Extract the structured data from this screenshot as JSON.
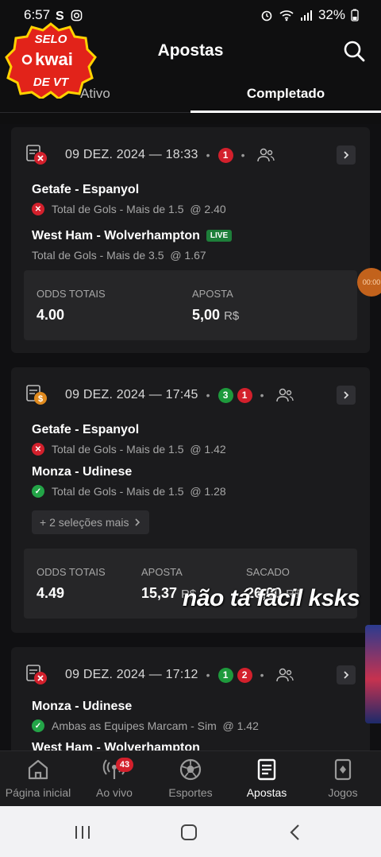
{
  "status_bar": {
    "time": "6:57",
    "battery": "32%"
  },
  "overlay_badge": {
    "line1": "SELO",
    "line2": "kwai",
    "line3": "DE VT"
  },
  "header": {
    "title": "Apostas"
  },
  "tabs": [
    {
      "label": "Ativo",
      "active": false
    },
    {
      "label": "Completado",
      "active": true
    }
  ],
  "bets": [
    {
      "datetime": "09 DEZ. 2024 — 18:33",
      "won_count": null,
      "lost_count": "1",
      "status_icon": "ticket-lost-icon",
      "selections": [
        {
          "match": "Getafe - Espanyol",
          "market": "Total de Gols - Mais de 1.5",
          "odd": "@ 2.40",
          "result": "lost",
          "live": false
        },
        {
          "match": "West Ham - Wolverhampton",
          "market": "Total de Gols - Mais de 3.5",
          "odd": "@ 1.67",
          "result": null,
          "live": true,
          "live_label": "LIVE"
        }
      ],
      "summary": {
        "odds_label": "ODDS TOTAIS",
        "odds_value": "4.00",
        "stake_label": "APOSTA",
        "stake_value": "5,00",
        "currency": "R$"
      }
    },
    {
      "datetime": "09 DEZ. 2024 — 17:45",
      "won_count": "3",
      "lost_count": "1",
      "status_icon": "ticket-cashout-icon",
      "selections": [
        {
          "match": "Getafe - Espanyol",
          "market": "Total de Gols - Mais de 1.5",
          "odd": "@ 1.42",
          "result": "lost"
        },
        {
          "match": "Monza - Udinese",
          "market": "Total de Gols - Mais de 1.5",
          "odd": "@ 1.28",
          "result": "won"
        }
      ],
      "more_label": "+ 2 seleções mais",
      "summary": {
        "odds_label": "ODDS TOTAIS",
        "odds_value": "4.49",
        "stake_label": "APOSTA",
        "stake_value": "15,37",
        "currency": "R$",
        "cashout_label": "SACADO",
        "cashout_value": "26,00",
        "cashout_currency": "R$"
      }
    },
    {
      "datetime": "09 DEZ. 2024 — 17:12",
      "won_count": "1",
      "lost_count": "2",
      "status_icon": "ticket-lost-icon",
      "selections": [
        {
          "match": "Monza - Udinese",
          "market": "Ambas as Equipes Marcam - Sim",
          "odd": "@ 1.42",
          "result": "won"
        },
        {
          "match": "West Ham - Wolverhampton"
        }
      ]
    }
  ],
  "caption_overlay": "não tá fácil ksks",
  "floating_timer": "00:00",
  "bottom_nav": [
    {
      "label": "Página inicial",
      "icon": "home-icon",
      "active": false
    },
    {
      "label": "Ao vivo",
      "icon": "live-icon",
      "active": false,
      "badge": "43"
    },
    {
      "label": "Esportes",
      "icon": "soccer-ball-icon",
      "active": false
    },
    {
      "label": "Apostas",
      "icon": "betslip-icon",
      "active": true
    },
    {
      "label": "Jogos",
      "icon": "cards-icon",
      "active": false
    }
  ],
  "colors": {
    "background": "#0f0f10",
    "card": "#1b1b1d",
    "lost": "#d3202c",
    "won": "#23a447",
    "live": "#1e7f3a"
  }
}
